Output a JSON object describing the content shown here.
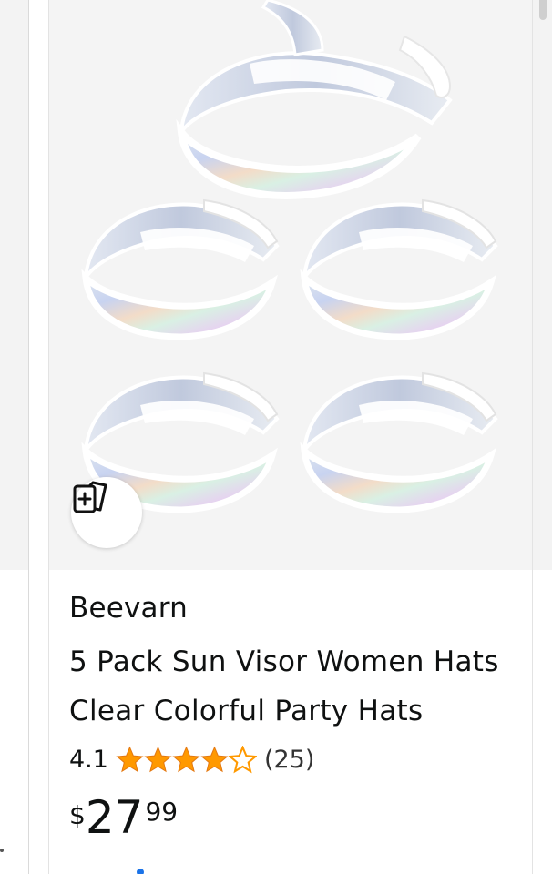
{
  "product": {
    "brand": "Beevarn",
    "title": "5 Pack Sun Visor Women Hats Clear Colorful Party Hats",
    "rating": "4.1",
    "stars_filled": 4,
    "stars_total": 5,
    "review_count": "(25)",
    "price": {
      "symbol": "$",
      "whole": "27",
      "fraction": "99"
    },
    "image_alt": "5 holographic sun visors"
  },
  "colors": {
    "star": "#ff9900",
    "text": "#0f1111",
    "image_bg": "#f4f4f4"
  },
  "icons": {
    "compare": "compare-cards-icon",
    "star": "star-icon"
  }
}
